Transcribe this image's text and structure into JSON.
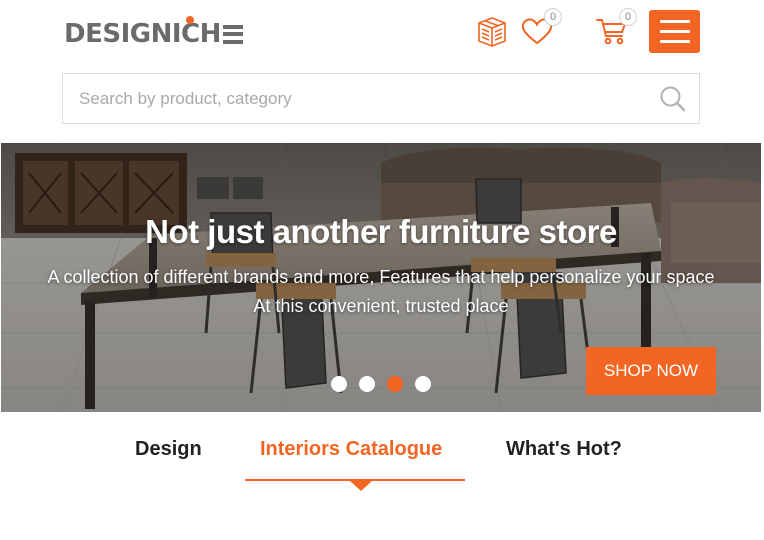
{
  "brand": {
    "logo_text": "DESIGNICH",
    "accent_color": "#f26522",
    "logo_color": "#6b6b6b"
  },
  "header": {
    "wishlist_count": "0",
    "cart_count": "0",
    "icons": [
      "catalogue-icon",
      "heart-icon",
      "cart-icon",
      "hamburger-menu-icon"
    ]
  },
  "search": {
    "placeholder": "Search by product, category",
    "value": ""
  },
  "hero": {
    "title": "Not just another furniture store",
    "subtitle_line1": "A collection of different brands and more, Features that help personalize your space",
    "subtitle_line2": "At this convenient, trusted place",
    "cta_label": "SHOP NOW",
    "slides_total": 4,
    "active_slide": 3
  },
  "tabs": [
    {
      "label": "Design",
      "active": false
    },
    {
      "label": "Interiors Catalogue",
      "active": true
    },
    {
      "label": "What's Hot?",
      "active": false
    }
  ]
}
